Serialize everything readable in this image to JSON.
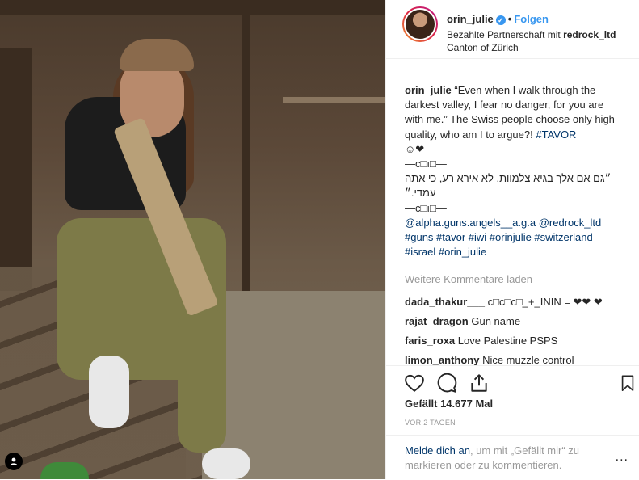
{
  "post": {
    "username": "orin_julie",
    "follow_label": "Folgen",
    "separator": "•",
    "sponsored_prefix": "Bezahlte Partnerschaft mit",
    "sponsor": "redrock_ltd",
    "location": "Canton of Zürich"
  },
  "caption": {
    "username": "orin_julie",
    "line1": " “Even when I walk through the darkest valley, I fear no danger, for you are with me.” The Swiss people choose only high quality, who am I to argue?! ",
    "hashtag_tavor": "#TAVOR",
    "emoji_line": "☺❤",
    "sep1": "—c□ı□—",
    "hebrew": "״גם אם אלך בגיא צלמוות, לא אירא רע, כי אתה עמדי.״",
    "sep2": "—c□ı□—",
    "mentions": "@alpha.guns.angels__a.g.a @redrock_ltd",
    "tags1": "#guns #tavor #iwi #orinjulie #switzerland",
    "tags2": "#israel #orin_julie"
  },
  "more_comments": "Weitere Kommentare laden",
  "comments": [
    {
      "user": "dada_thakur___",
      "text": " c□c□c□_+_ININ = ❤❤ ❤"
    },
    {
      "user": "rajat_dragon",
      "text": " Gun name"
    },
    {
      "user": "faris_roxa",
      "text": " Love Palestine PSPS"
    },
    {
      "user": "limon_anthony",
      "text": " Nice muzzle control"
    }
  ],
  "actions": {
    "like_icon": "heart-icon",
    "comment_icon": "comment-icon",
    "share_icon": "share-icon",
    "save_icon": "bookmark-icon"
  },
  "likes": "Gefällt 14.677 Mal",
  "date": "VOR 2 TAGEN",
  "login": {
    "link": "Melde dich an",
    "rest": ", um mit „Gefällt mir“ zu markieren oder zu kommentieren.",
    "menu": "..."
  },
  "colors": {
    "accent": "#3897f0",
    "link": "#003569",
    "muted": "#999999"
  }
}
